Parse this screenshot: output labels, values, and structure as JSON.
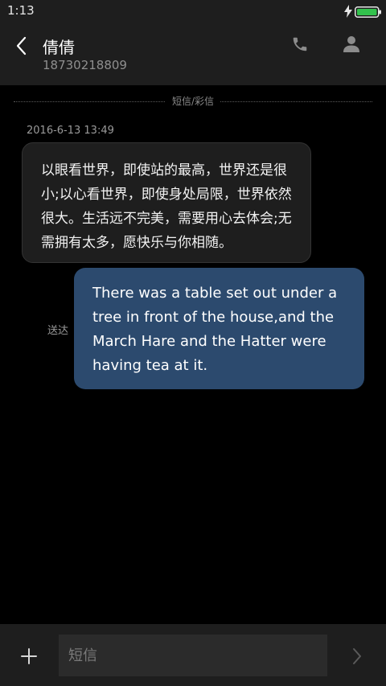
{
  "status_bar": {
    "time": "1:13",
    "battery_color": "#33c24d"
  },
  "header": {
    "contact_name": "倩倩",
    "contact_number": "18730218809"
  },
  "thread": {
    "divider_label": "短信/彩信",
    "messages": [
      {
        "direction": "incoming",
        "timestamp": "2016-6-13 13:49",
        "text": "以眼看世界，即使站的最高，世界还是很小;以心看世界，即使身处局限，世界依然很大。生活远不完美，需要用心去体会;无需拥有太多，愿快乐与你相随。"
      },
      {
        "direction": "outgoing",
        "status": "送达",
        "text": "There was a table set out under a tree in front of the house,and the March Hare and the Hatter were having tea at it."
      }
    ]
  },
  "composer": {
    "placeholder": "短信"
  },
  "icons": {
    "back": "chevron-left-icon",
    "call": "phone-icon",
    "contact": "person-icon",
    "attach": "plus-icon",
    "send": "chevron-right-icon",
    "charging": "bolt-icon",
    "battery": "battery-icon"
  },
  "colors": {
    "background": "#000000",
    "bar_background": "#1e1e1e",
    "incoming_bubble": "#1e1e1e",
    "outgoing_bubble": "#2c4a6e",
    "input_background": "#2b2b2b"
  }
}
